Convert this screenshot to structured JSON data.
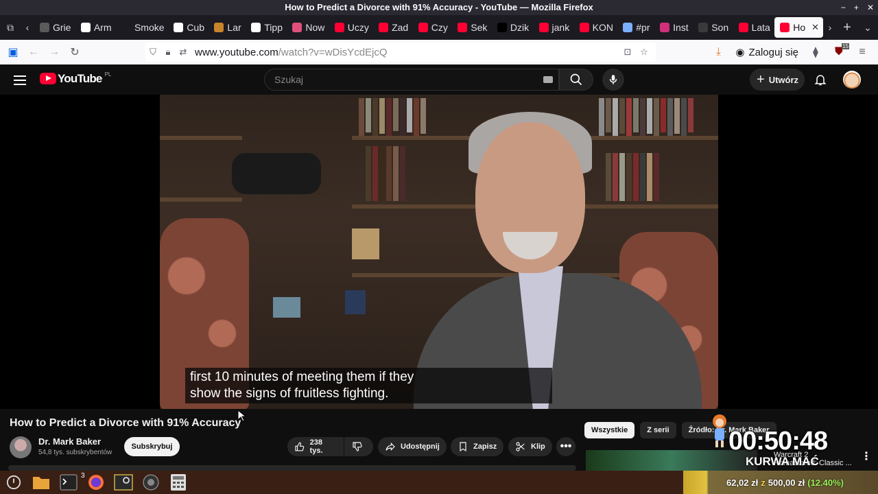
{
  "window": {
    "title": "How to Predict a Divorce with 91% Accuracy - YouTube — Mozilla Firefox"
  },
  "tabs": [
    {
      "label": "Grie",
      "color": "#5a5a5a"
    },
    {
      "label": "Arm",
      "color": "#ffffff"
    },
    {
      "label": "Smoke",
      "color": "#1c1b22"
    },
    {
      "label": "Cub",
      "color": "#ffffff"
    },
    {
      "label": "Lar",
      "color": "#c8842a"
    },
    {
      "label": "Tipp",
      "color": "#ffffff"
    },
    {
      "label": "Now",
      "color": "#e0507a"
    },
    {
      "label": "Uczy",
      "color": "#ff0033"
    },
    {
      "label": "Zad",
      "color": "#ff0033"
    },
    {
      "label": "Czy",
      "color": "#ff0033"
    },
    {
      "label": "Sek",
      "color": "#ff0033"
    },
    {
      "label": "Dzik",
      "color": "#000000"
    },
    {
      "label": "jank",
      "color": "#ff0033"
    },
    {
      "label": "KON",
      "color": "#ff0033"
    },
    {
      "label": "#pr",
      "color": "#7ab0ff"
    },
    {
      "label": "Inst",
      "color": "#d0307a"
    },
    {
      "label": "Son",
      "color": "#3a3a3a"
    },
    {
      "label": "Lata",
      "color": "#ff0033"
    },
    {
      "label": "Ho",
      "color": "#ff0033",
      "active": true
    }
  ],
  "nav": {
    "url_domain": "www.youtube.com",
    "url_path": "/watch?v=wDisYcdEjcQ",
    "login_label": "Zaloguj się",
    "ublock_count": "15"
  },
  "youtube": {
    "logo_text": "YouTube",
    "country": "PL",
    "search_placeholder": "Szukaj",
    "create_label": "Utwórz"
  },
  "video": {
    "subtitle_line1": "first 10 minutes of meeting them if they",
    "subtitle_line2": "show the signs of fruitless fighting."
  },
  "meta": {
    "title": "How to Predict a Divorce with 91% Accuracy",
    "channel": "Dr. Mark Baker",
    "subscribers": "54,8 tys. subskrybentów",
    "subscribe_label": "Subskrybuj",
    "likes": "238 tys.",
    "share_label": "Udostępnij",
    "save_label": "Zapisz",
    "clip_label": "Klip"
  },
  "chips": [
    "Wszystkie",
    "Z serii",
    "Źródło: Dr. Mark Baker"
  ],
  "overlay": {
    "timer": "00:50:48",
    "caption": "KURWA MAĆ",
    "related_line1": "Warcraft 2",
    "related_line2": "Remastered: Classic ..."
  },
  "taskbar": {
    "firefox_badge": "3",
    "donation_current": "62,02 zł",
    "donation_sep": "z",
    "donation_goal": "500,00 zł",
    "donation_pct": "(12.40%)"
  }
}
